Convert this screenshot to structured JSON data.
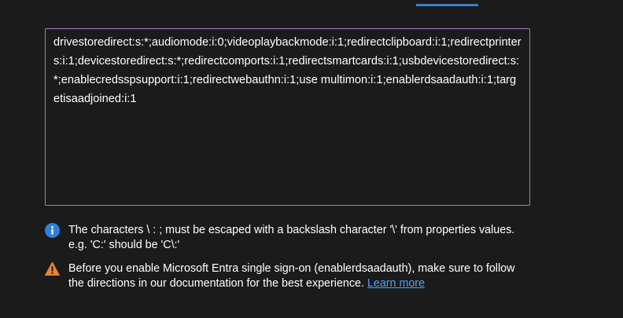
{
  "rdp_properties": {
    "value": "drivestoredirect:s:*;audiomode:i:0;videoplaybackmode:i:1;redirectclipboard:i:1;redirectprinters:i:1;devicestoredirect:s:*;redirectcomports:i:1;redirectsmartcards:i:1;usbdevicestoredirect:s:*;enablecredsspsupport:i:1;redirectwebauthn:i:1;use multimon:i:1;enablerdsaadauth:i:1;targetisaadjoined:i:1"
  },
  "info_message": {
    "icon": "info-icon",
    "text": "The characters \\ : ; must be escaped with a backslash character '\\' from properties values. e.g. 'C:' should be 'C\\:'"
  },
  "warning_message": {
    "icon": "warning-icon",
    "text": "Before you enable Microsoft Entra single sign-on (enablerdsaadauth), make sure to follow the directions in our documentation for the best experience.",
    "link_label": "Learn more"
  },
  "colors": {
    "background": "#1b1b1b",
    "textarea_border": "#b46ed6",
    "tab_indicator": "#3a7fc8",
    "info_icon": "#2f7fd8",
    "warning_icon": "#e6852f",
    "link": "#4fa3f2"
  }
}
